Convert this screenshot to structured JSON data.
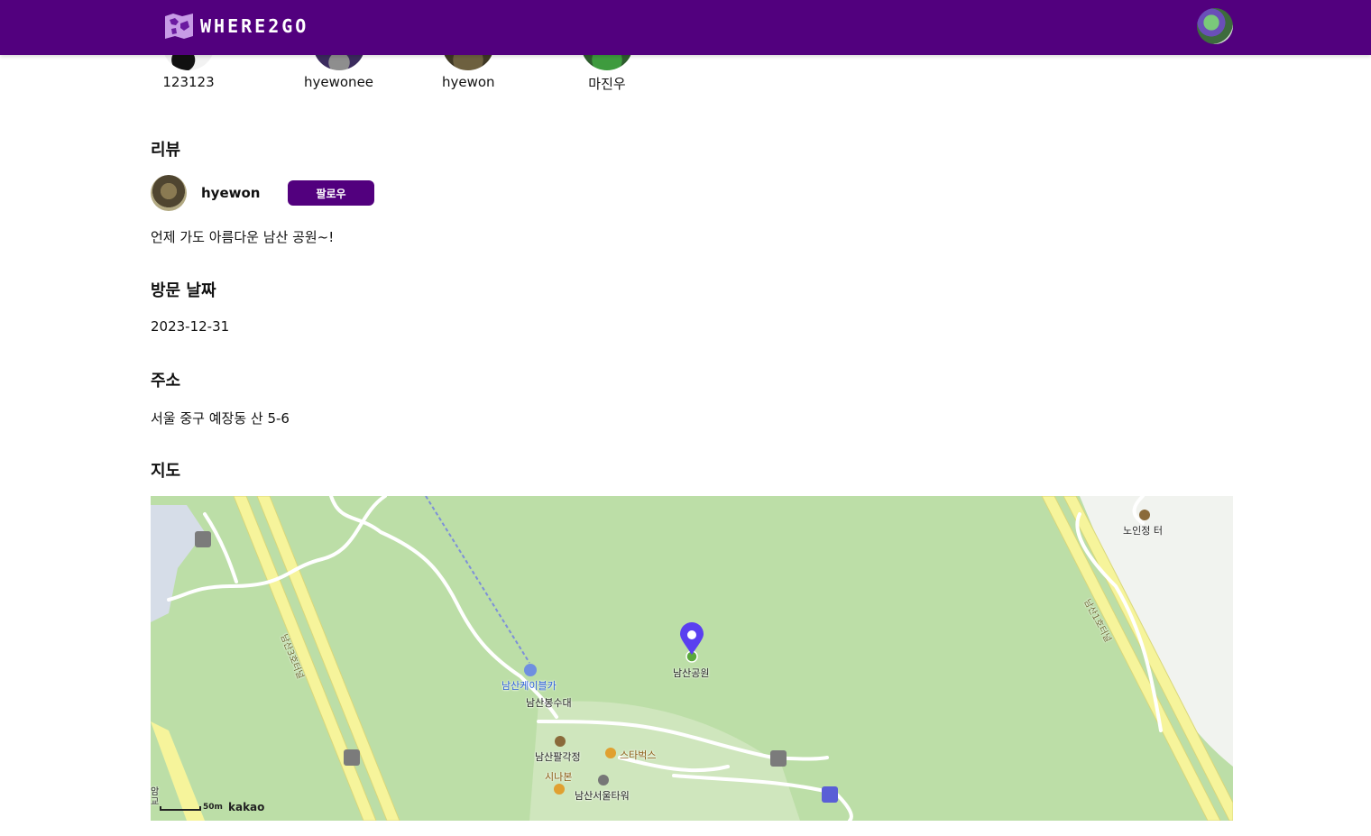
{
  "header": {
    "logo_text": "WHERE2GO"
  },
  "followers": [
    {
      "name": "123123"
    },
    {
      "name": "hyewonee"
    },
    {
      "name": "hyewon"
    },
    {
      "name": "마진우"
    }
  ],
  "review": {
    "title": "리뷰",
    "username": "hyewon",
    "follow_label": "팔로우",
    "text": "언제 가도 아름다운 남산 공원~!"
  },
  "visit": {
    "title": "방문 날짜",
    "date": "2023-12-31"
  },
  "address": {
    "title": "주소",
    "value": "서울 중구 예장동 산 5-6"
  },
  "map": {
    "title": "지도",
    "marker_label": "남산공원",
    "labels": {
      "cablecar": "남산케이블카",
      "beacon": "남산봉수대",
      "pavilion": "남산팔각정",
      "starbucks": "스타벅스",
      "shinabon": "시나본",
      "tower": "남산서울타워",
      "senior": "노인정 터",
      "tunnel3": "남산3호터널",
      "tunnel1": "남산1호터널",
      "edge": "암 교"
    },
    "scale": "50m",
    "brand": "kakao",
    "colors": {
      "park": "#bcdea7",
      "road": "#f6f49b",
      "marker": "#5a3ff0"
    }
  },
  "colors": {
    "brand": "#52007e"
  }
}
